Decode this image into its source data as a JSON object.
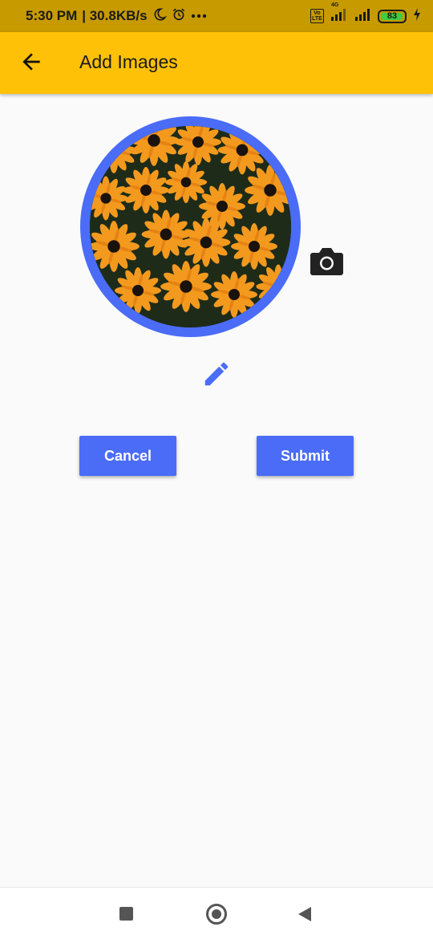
{
  "status_bar": {
    "time": "5:30 PM",
    "speed": "| 30.8KB/s",
    "network_label": "4G",
    "volte_label": "Vo LTE",
    "battery_level": "83",
    "battery_fraction": 0.83,
    "icons": [
      "moon-icon",
      "alarm-icon",
      "more-dots-icon",
      "volte-icon",
      "signal-icon",
      "signal-icon",
      "battery-icon",
      "charging-icon"
    ]
  },
  "app_bar": {
    "title": "Add Images",
    "back_icon": "arrow-left-icon",
    "background": "#ffc107"
  },
  "avatar": {
    "image_description_icon": "flower-photo",
    "ring_color": "#4a6cf7",
    "camera_icon": "camera-icon",
    "edit_icon": "pencil-icon"
  },
  "actions": {
    "cancel_label": "Cancel",
    "submit_label": "Submit",
    "button_color": "#4a6cf7"
  },
  "nav_bar": {
    "icons": [
      "recent-apps-icon",
      "home-icon",
      "back-triangle-icon"
    ]
  }
}
